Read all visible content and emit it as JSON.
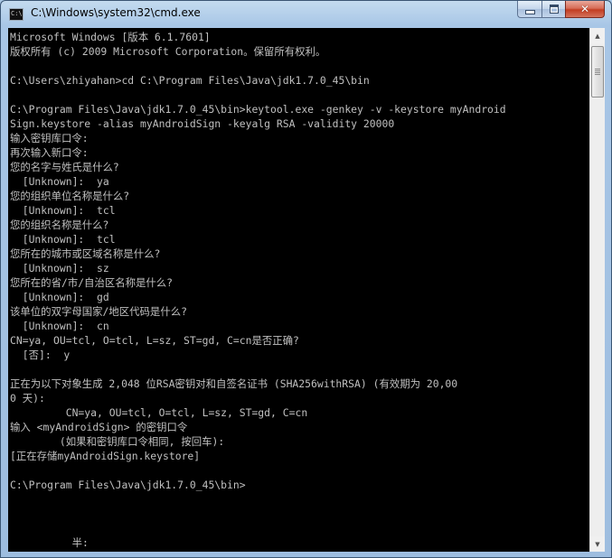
{
  "window": {
    "title": "C:\\Windows\\system32\\cmd.exe",
    "app_icon_text": "C:\\",
    "buttons": {
      "minimize": "minimize",
      "maximize": "maximize",
      "close": "✕"
    }
  },
  "console": {
    "lines": [
      "Microsoft Windows [版本 6.1.7601]",
      "版权所有 (c) 2009 Microsoft Corporation。保留所有权利。",
      "",
      "C:\\Users\\zhiyahan>cd C:\\Program Files\\Java\\jdk1.7.0_45\\bin",
      "",
      "C:\\Program Files\\Java\\jdk1.7.0_45\\bin>keytool.exe -genkey -v -keystore myAndroid",
      "Sign.keystore -alias myAndroidSign -keyalg RSA -validity 20000",
      "输入密钥库口令:",
      "再次输入新口令:",
      "您的名字与姓氏是什么?",
      "  [Unknown]:  ya",
      "您的组织单位名称是什么?",
      "  [Unknown]:  tcl",
      "您的组织名称是什么?",
      "  [Unknown]:  tcl",
      "您所在的城市或区域名称是什么?",
      "  [Unknown]:  sz",
      "您所在的省/市/自治区名称是什么?",
      "  [Unknown]:  gd",
      "该单位的双字母国家/地区代码是什么?",
      "  [Unknown]:  cn",
      "CN=ya, OU=tcl, O=tcl, L=sz, ST=gd, C=cn是否正确?",
      "  [否]:  y",
      "",
      "正在为以下对象生成 2,048 位RSA密钥对和自签名证书 (SHA256withRSA) (有效期为 20,00",
      "0 天):",
      "         CN=ya, OU=tcl, O=tcl, L=sz, ST=gd, C=cn",
      "输入 <myAndroidSign> 的密钥口令",
      "        (如果和密钥库口令相同, 按回车):",
      "[正在存储myAndroidSign.keystore]",
      "",
      "C:\\Program Files\\Java\\jdk1.7.0_45\\bin>",
      "",
      "",
      "",
      "          半:"
    ]
  },
  "scrollbar": {
    "up_arrow": "▲",
    "down_arrow": "▼"
  }
}
